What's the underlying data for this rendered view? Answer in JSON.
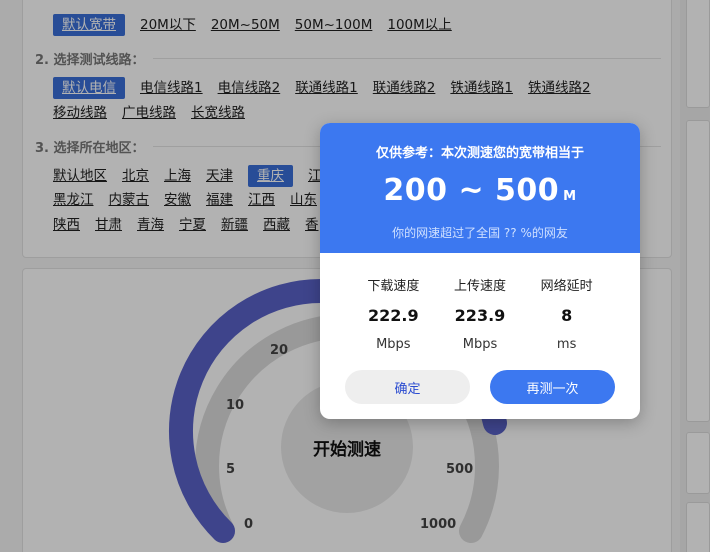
{
  "bandwidth": {
    "options": [
      "默认宽带",
      "20M以下",
      "20M~50M",
      "50M~100M",
      "100M以上"
    ],
    "selected": "默认宽带"
  },
  "route": {
    "title": "2. 选择测试线路：",
    "row1": [
      "默认电信",
      "电信线路1",
      "电信线路2",
      "联通线路1",
      "联通线路2",
      "铁通线路1",
      "铁通线路2"
    ],
    "row2": [
      "移动线路",
      "广电线路",
      "长宽线路"
    ],
    "selected": "默认电信"
  },
  "region": {
    "title": "3. 选择所在地区：",
    "row1": [
      "默认地区",
      "北京",
      "上海",
      "天津",
      "重庆",
      "江"
    ],
    "row2": [
      "黑龙江",
      "内蒙古",
      "安徽",
      "福建",
      "江西",
      "山东"
    ],
    "row3": [
      "陕西",
      "甘肃",
      "青海",
      "宁夏",
      "新疆",
      "西藏",
      "香"
    ],
    "selected": "重庆"
  },
  "gauge": {
    "ticks": [
      "0",
      "5",
      "10",
      "20",
      "500",
      "1000"
    ],
    "start_label": "开始测速",
    "arc_color": "#5a62c8"
  },
  "modal": {
    "title": "仅供参考：本次测速您的宽带相当于",
    "range": "200 ~ 500",
    "range_unit": "M",
    "subtitle": "你的网速超过了全国 ?? %的网友",
    "stats": [
      {
        "label": "下载速度",
        "value": "222.9",
        "unit": "Mbps"
      },
      {
        "label": "上传速度",
        "value": "223.9",
        "unit": "Mbps"
      },
      {
        "label": "网络延时",
        "value": "8",
        "unit": "ms"
      }
    ],
    "ok_label": "确定",
    "retest_label": "再测一次",
    "header_color": "#3c78f0"
  }
}
